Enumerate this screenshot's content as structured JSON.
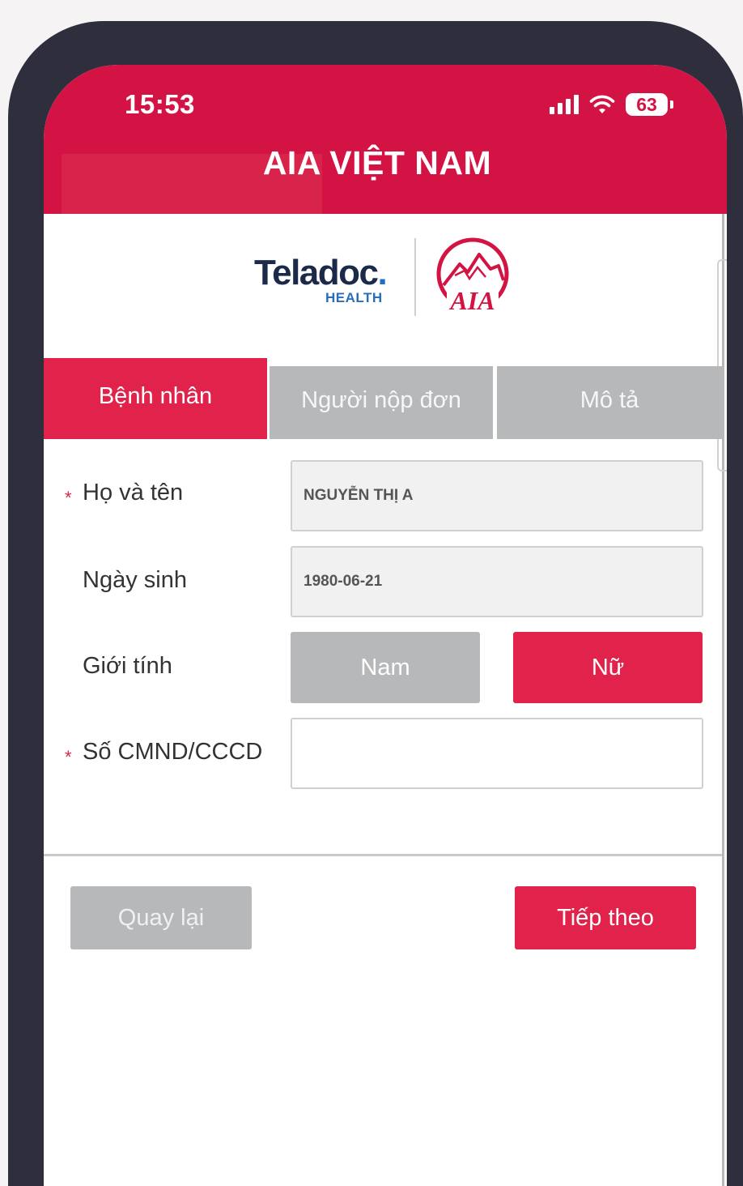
{
  "status_bar": {
    "time": "15:53",
    "battery": "63"
  },
  "header": {
    "title": "AIA VIỆT NAM"
  },
  "logos": {
    "teladoc": "Teladoc",
    "teladoc_dot": ".",
    "health": "HEALTH",
    "aia": "AIA"
  },
  "tabs": [
    {
      "label": "Bệnh nhân",
      "active": true
    },
    {
      "label": "Người nộp đơn",
      "active": false
    },
    {
      "label": "Mô tả",
      "active": false
    }
  ],
  "form": {
    "required_mark": "*",
    "full_name": {
      "label": "Họ và tên",
      "value": "NGUYỄN THỊ A"
    },
    "dob": {
      "label": "Ngày sinh",
      "value": "1980-06-21"
    },
    "gender": {
      "label": "Giới tính",
      "options": [
        "Nam",
        "Nữ"
      ],
      "selected": "Nữ"
    },
    "id_number": {
      "label": "Số CMND/CCCD",
      "value": ""
    }
  },
  "actions": {
    "back_label": "Quay lại",
    "next_label": "Tiếp theo"
  },
  "colors": {
    "brand": "#d31344",
    "accent": "#e1224a",
    "inactive": "#b6b8ba"
  }
}
